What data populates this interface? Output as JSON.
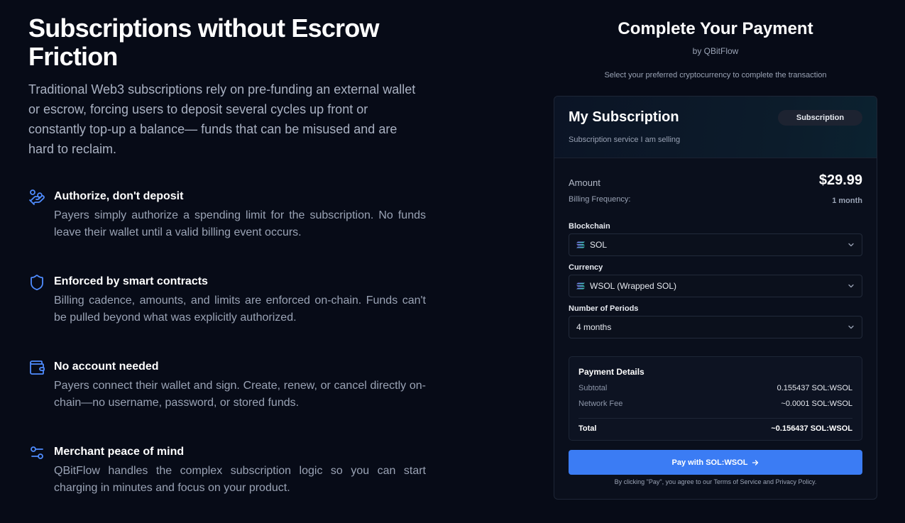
{
  "hero": {
    "title": "Subscriptions without Escrow Friction",
    "description": "Traditional Web3 subscriptions rely on pre-funding an external wallet or escrow, forcing users to deposit several cycles up front or constantly top-up a balance— funds that can be misused and are hard to reclaim."
  },
  "features": [
    {
      "icon": "hand-coins-icon",
      "title": "Authorize, don't deposit",
      "text": "Payers simply authorize a spending limit for the subscription. No funds leave their wallet until a valid billing event occurs."
    },
    {
      "icon": "shield-icon",
      "title": "Enforced by smart contracts",
      "text": "Billing cadence, amounts, and limits are enforced on-chain. Funds can't be pulled beyond what was explicitly authorized."
    },
    {
      "icon": "wallet-icon",
      "title": "No account needed",
      "text": "Payers connect their wallet and sign. Create, renew, or cancel directly on-chain—no username, password, or stored funds."
    },
    {
      "icon": "sliders-icon",
      "title": "Merchant peace of mind",
      "text": "QBitFlow handles the complex subscription logic so you can start charging in minutes and focus on your product."
    }
  ],
  "payment": {
    "title": "Complete Your Payment",
    "by": "by QBitFlow",
    "subtitle": "Select your preferred cryptocurrency to complete the transaction",
    "product": {
      "name": "My Subscription",
      "badge": "Subscription",
      "description": "Subscription service I am selling"
    },
    "amount_label": "Amount",
    "amount_value": "$29.99",
    "frequency_label": "Billing Frequency:",
    "frequency_value": "1 month",
    "blockchain_label": "Blockchain",
    "blockchain_value": "SOL",
    "currency_label": "Currency",
    "currency_value": "WSOL (Wrapped SOL)",
    "periods_label": "Number of Periods",
    "periods_value": "4 months",
    "details": {
      "title": "Payment Details",
      "subtotal_label": "Subtotal",
      "subtotal_value": "0.155437 SOL:WSOL",
      "fee_label": "Network Fee",
      "fee_value": "~0.0001 SOL:WSOL",
      "total_label": "Total",
      "total_value": "~0.156437 SOL:WSOL"
    },
    "pay_button": "Pay with SOL:WSOL",
    "terms": "By clicking \"Pay\", you agree to our Terms of Service and Privacy Policy."
  },
  "colors": {
    "background": "#070b17",
    "accent": "#3b7cf4",
    "icon": "#4f8cff"
  }
}
